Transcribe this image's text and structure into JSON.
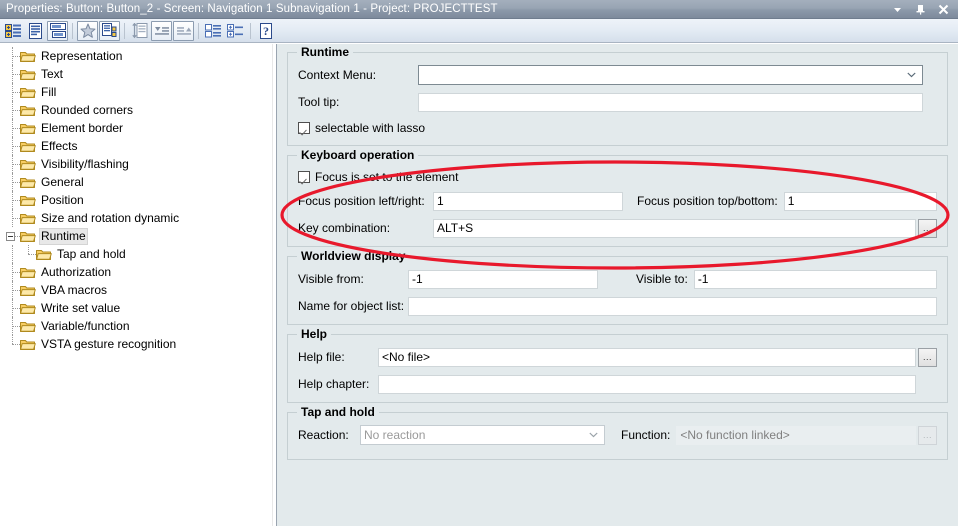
{
  "window": {
    "title": "Properties: Button: Button_2 - Screen: Navigation 1 Subnavigation 1 - Project: PROJECTTEST",
    "buttons": [
      {
        "name": "dropdown-menu-button",
        "glyph": "▼"
      },
      {
        "name": "pin-button",
        "glyph": "⊥"
      },
      {
        "name": "close-button",
        "glyph": "✕"
      }
    ]
  },
  "toolbar": {
    "items": [
      {
        "name": "categorized-view-button",
        "tooltip": "Categorized"
      },
      {
        "name": "alphabetical-view-button",
        "tooltip": "Alphabetical"
      },
      {
        "name": "property-pages-button",
        "tooltip": "Property Pages",
        "pressed": true
      },
      {
        "name": "favorites-button",
        "tooltip": "Favorites"
      },
      {
        "name": "object-list-button",
        "tooltip": "Object list"
      },
      {
        "name": "sort-order-button",
        "tooltip": "Sort order"
      },
      {
        "name": "collapse-down-button",
        "tooltip": "Collapse"
      },
      {
        "name": "expand-up-button",
        "tooltip": "Expand"
      },
      {
        "name": "group-list-button",
        "tooltip": "Group"
      },
      {
        "name": "expand-collapse-all-button",
        "tooltip": "Expand all"
      },
      {
        "name": "help-button",
        "tooltip": "Help"
      }
    ]
  },
  "tree": {
    "items": [
      {
        "label": "Representation",
        "level": 1,
        "selected": false
      },
      {
        "label": "Text",
        "level": 1,
        "selected": false
      },
      {
        "label": "Fill",
        "level": 1,
        "selected": false
      },
      {
        "label": "Rounded corners",
        "level": 1,
        "selected": false
      },
      {
        "label": "Element border",
        "level": 1,
        "selected": false
      },
      {
        "label": "Effects",
        "level": 1,
        "selected": false
      },
      {
        "label": "Visibility/flashing",
        "level": 1,
        "selected": false
      },
      {
        "label": "General",
        "level": 1,
        "selected": false
      },
      {
        "label": "Position",
        "level": 1,
        "selected": false
      },
      {
        "label": "Size and rotation dynamic",
        "level": 1,
        "selected": false
      },
      {
        "label": "Runtime",
        "level": 1,
        "selected": true,
        "expanded": true
      },
      {
        "label": "Tap and hold",
        "level": 2,
        "selected": false
      },
      {
        "label": "Authorization",
        "level": 1,
        "selected": false
      },
      {
        "label": "VBA macros",
        "level": 1,
        "selected": false
      },
      {
        "label": "Write set value",
        "level": 1,
        "selected": false
      },
      {
        "label": "Variable/function",
        "level": 1,
        "selected": false
      },
      {
        "label": "VSTA gesture recognition",
        "level": 1,
        "selected": false
      }
    ]
  },
  "groups": {
    "runtime": {
      "title": "Runtime",
      "context_menu_label": "Context Menu:",
      "context_menu_value": "",
      "tooltip_label": "Tool tip:",
      "tooltip_value": "",
      "lasso_label": "selectable with lasso",
      "lasso_checked": true
    },
    "keyboard": {
      "title": "Keyboard operation",
      "focus_checkbox_label": "Focus is set to the element",
      "focus_checked": true,
      "focus_lr_label": "Focus position left/right:",
      "focus_lr_value": "1",
      "focus_tb_label": "Focus position top/bottom:",
      "focus_tb_value": "1",
      "key_combo_label": "Key combination:",
      "key_combo_value": "ALT+S",
      "key_combo_browse": "..."
    },
    "worldview": {
      "title": "Worldview display",
      "visible_from_label": "Visible from:",
      "visible_from_value": "-1",
      "visible_to_label": "Visible to:",
      "visible_to_value": "-1",
      "object_list_label": "Name for object list:",
      "object_list_value": ""
    },
    "help": {
      "title": "Help",
      "help_file_label": "Help file:",
      "help_file_value": "<No file>",
      "help_file_browse": "...",
      "help_chapter_label": "Help chapter:",
      "help_chapter_value": ""
    },
    "taphold": {
      "title": "Tap and hold",
      "reaction_label": "Reaction:",
      "reaction_value": "No reaction",
      "function_label": "Function:",
      "function_value": "<No function linked>",
      "function_browse": "..."
    }
  },
  "annotation": {
    "name": "red-highlight-ellipse",
    "color": "#e8192c",
    "target": "keyboard-operation-group"
  }
}
